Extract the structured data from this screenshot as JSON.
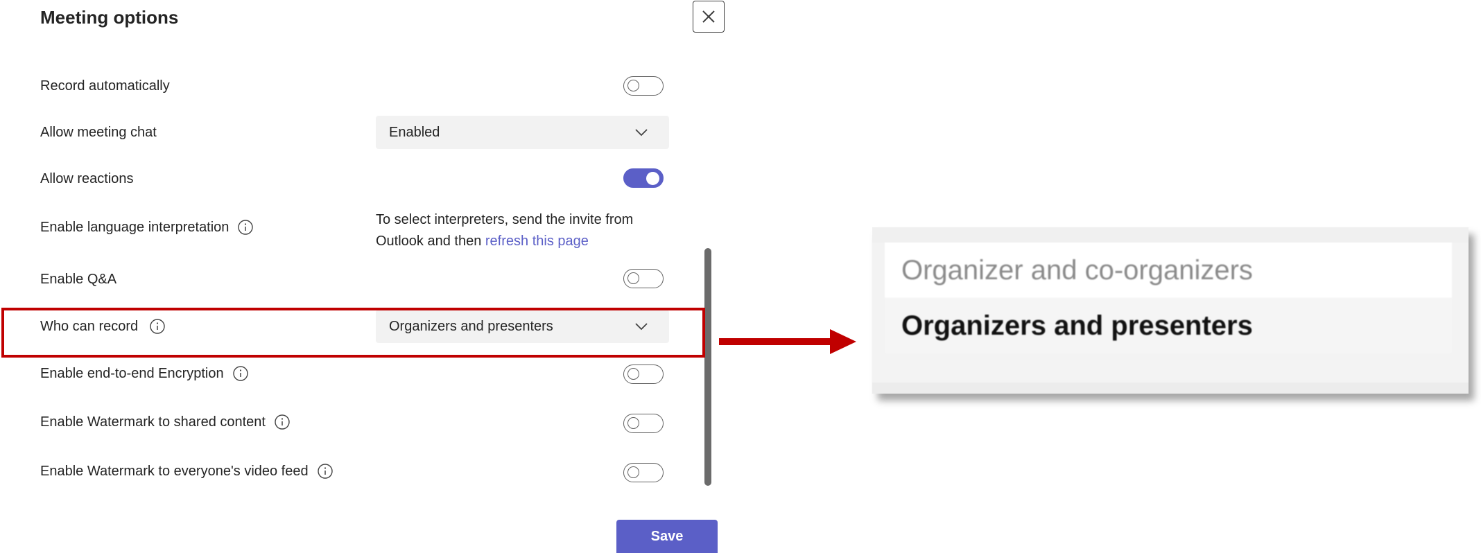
{
  "dialog": {
    "title": "Meeting options",
    "close_icon": "close-icon"
  },
  "options": {
    "record_automatically": {
      "label": "Record automatically",
      "on": false
    },
    "allow_meeting_chat": {
      "label": "Allow meeting chat",
      "value": "Enabled"
    },
    "allow_reactions": {
      "label": "Allow reactions",
      "on": true
    },
    "language_interpretation": {
      "label": "Enable language interpretation",
      "note_prefix": "To select interpreters, send the invite from Outlook and then ",
      "note_link": "refresh this page"
    },
    "enable_qa": {
      "label": "Enable Q&A",
      "on": false
    },
    "who_can_record": {
      "label": "Who can record",
      "value": "Organizers and presenters"
    },
    "end_to_end_encryption": {
      "label": "Enable end-to-end Encryption",
      "on": false
    },
    "watermark_shared_content": {
      "label": "Enable Watermark to shared content",
      "on": false
    },
    "watermark_video_feed": {
      "label": "Enable Watermark to everyone's video feed",
      "on": false
    }
  },
  "footer": {
    "save_label": "Save"
  },
  "callout": {
    "highlight_color": "#c00000",
    "options": [
      "Organizer and co-organizers",
      "Organizers and presenters"
    ],
    "selected": "Organizers and presenters"
  },
  "colors": {
    "accent": "#5b5fc7",
    "highlight": "#c00000"
  }
}
